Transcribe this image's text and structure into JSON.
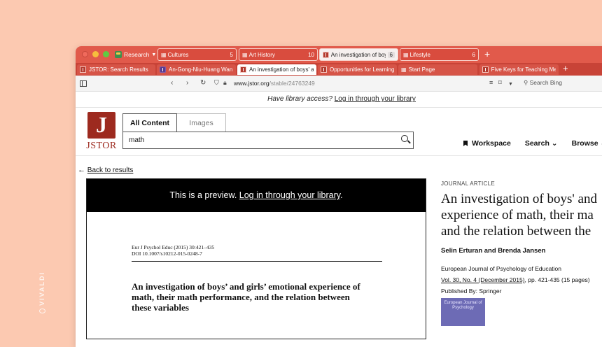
{
  "desktop": {
    "brand": "VIVALDI"
  },
  "titlebar": {
    "workspace_label": "Research",
    "tab_stacks": [
      {
        "label": "Cultures",
        "count": "5"
      },
      {
        "label": "Art History",
        "count": "10"
      },
      {
        "label": "An investigation of boy",
        "count": "6"
      },
      {
        "label": "Lifestyle",
        "count": "6"
      }
    ],
    "new_tab": "+"
  },
  "subtabs": [
    {
      "label": "JSTOR: Search Results"
    },
    {
      "label": "An-Gong-Niu-Huang Wan"
    },
    {
      "label": "An investigation of boys' a"
    },
    {
      "label": "Opportunities for Learning"
    },
    {
      "label": "Start Page"
    },
    {
      "label": "Five Keys for Teaching Mer"
    }
  ],
  "addressbar": {
    "url_domain": "www.jstor.org",
    "url_path": "/stable/24763249",
    "search_placeholder": "Search Bing"
  },
  "page": {
    "access_prompt": "Have library access?",
    "access_link": "Log in through your library",
    "logo_text": "JSTOR",
    "search_tabs": [
      "All Content",
      "Images"
    ],
    "search_value": "math",
    "nav": {
      "workspace": "Workspace",
      "search": "Search",
      "browse": "Browse"
    },
    "back_link": "Back to results",
    "preview": {
      "banner_prefix": "This is a preview.",
      "banner_link": "Log in through your library",
      "banner_suffix": ".",
      "cite_line1": "Eur J Psychol Educ (2015) 30:421–435",
      "cite_line2": "DOI 10.1007/s10212-015-0248-7",
      "title": "An investigation of boys’ and girls’ emotional experience of math, their math performance, and the relation between these variables"
    },
    "meta": {
      "label": "JOURNAL ARTICLE",
      "title_line1": "An investigation of boys' and",
      "title_line2": "experience of math, their ma",
      "title_line3": "and the relation between the",
      "authors": "Selin Erturan and Brenda Jansen",
      "journal": "European Journal of Psychology of Education",
      "volume_link": "Vol. 30, No. 4 (December 2015)",
      "pages": ", pp. 421-435 (15 pages)",
      "publisher": "Published By: Springer",
      "cover_text": "European Journal of Psychology"
    }
  }
}
